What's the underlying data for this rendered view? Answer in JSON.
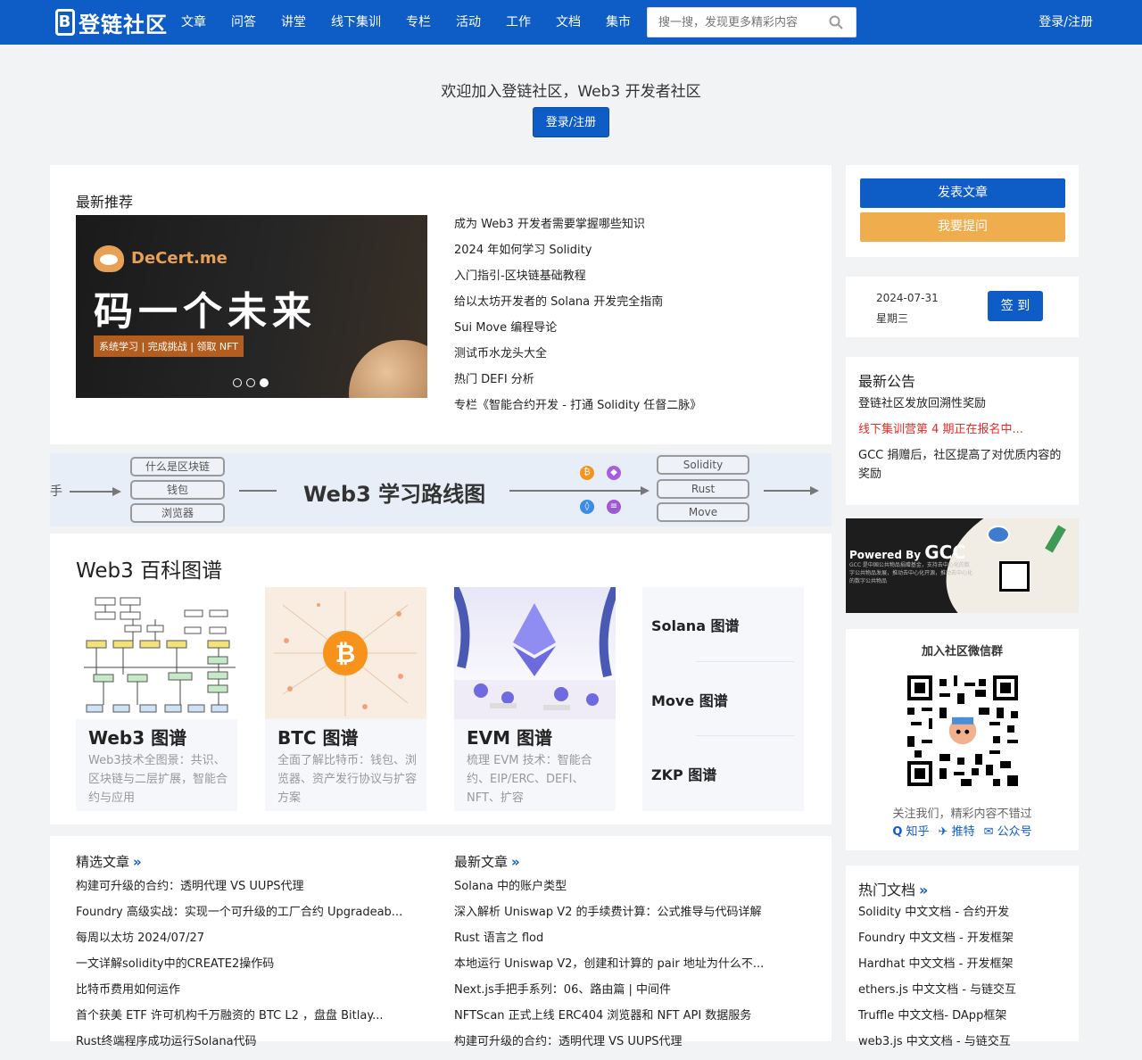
{
  "colors": {
    "primary": "#0e5cc5",
    "warning": "#f0ad4e",
    "alert": "#e52d27"
  },
  "nav": {
    "logo": "登链社区",
    "items": [
      "文章",
      "问答",
      "讲堂",
      "线下集训",
      "专栏",
      "活动",
      "工作",
      "文档",
      "集市"
    ],
    "search_placeholder": "搜一搜，发现更多精彩内容",
    "login": "登录/注册"
  },
  "welcome": {
    "text": "欢迎加入登链社区，Web3 开发者社区",
    "button": "登录/注册"
  },
  "recommend": {
    "title": "最新推荐",
    "banner": {
      "brand": "DeCert.me",
      "headline": "码一个未来",
      "tagline": "系统学习 | 完成挑战 | 领取 NFT"
    },
    "items": [
      "成为 Web3 开发者需要掌握哪些知识",
      "2024 年如何学习 Solidity",
      "入门指引-区块链基础教程",
      "给以太坊开发者的 Solana 开发完全指南",
      "Sui Move 编程导论",
      "测试币水龙头大全",
      "热门 DEFI 分析",
      "专栏《智能合约开发 - 打通 Solidity 任督二脉》"
    ]
  },
  "roadmap": {
    "title": "Web3 学习路线图",
    "left_label": "手",
    "left_boxes": [
      "什么是区块链",
      "钱包",
      "浏览器"
    ],
    "right_boxes": [
      "Solidity",
      "Rust",
      "Move"
    ]
  },
  "wiki": {
    "title": "Web3 百科图谱",
    "cards": [
      {
        "name": "Web3 图谱",
        "desc": "Web3技术全图景：共识、区块链与二层扩展，智能合约与应用"
      },
      {
        "name": "BTC 图谱",
        "desc": "全面了解比特币：钱包、浏览器、资产发行协议与扩容方案"
      },
      {
        "name": "EVM 图谱",
        "desc": "梳理 EVM 技术：智能合约、EIP/ERC、DEFI、NFT、扩容"
      }
    ],
    "side": [
      "Solana 图谱",
      "Move 图谱",
      "ZKP 图谱"
    ]
  },
  "featured": {
    "title": "精选文章",
    "more": "»",
    "items": [
      "构建可升级的合约：透明代理 VS UUPS代理",
      "Foundry 高级实战：实现一个可升级的工厂合约 Upgradeab...",
      "每周以太坊 2024/07/27",
      "一文详解solidity中的CREATE2操作码",
      "比特币费用如何运作",
      "首个获美 ETF 许可机构千万融资的 BTC L2 ，盘盘 Bitlay...",
      "Rust终端程序成功运行Solana代码"
    ]
  },
  "latest": {
    "title": "最新文章",
    "more": "»",
    "items": [
      "Solana 中的账户类型",
      "深入解析 Uniswap V2 的手续费计算：公式推导与代码详解",
      "Rust 语言之 flod",
      "本地运行 Uniswap V2，创建和计算的 pair 地址为什么不...",
      "Next.js手把手系列：06、路由篇 | 中间件",
      "NFTScan 正式上线 ERC404 浏览器和 NFT API 数据服务",
      "构建可升级的合约：透明代理 VS UUPS代理"
    ]
  },
  "sidebar": {
    "post": "发表文章",
    "ask": "我要提问",
    "date": "2024-07-31",
    "weekday": "星期三",
    "sign": "签 到",
    "notice_title": "最新公告",
    "notices": [
      "登链社区发放回溯性奖励",
      "线下集训营第 4 期正在报名中...",
      "GCC 捐赠后，社区提高了对优质内容的奖励"
    ],
    "gcc": {
      "powered": "Powered By",
      "name": "GCC",
      "desc": "GCC 是中国公共物品捐赠基金，支持去中心化的数字公共物品发展，推动去中心化开源，推动去中心化的数字公共物品"
    },
    "wechat_title": "加入社区微信群",
    "wechat_sub": "关注我们，精彩内容不错过",
    "social": [
      "知乎",
      "推特",
      "公众号"
    ],
    "docs_title": "热门文档",
    "docs_more": "»",
    "docs": [
      "Solidity 中文文档 - 合约开发",
      "Foundry 中文文档 - 开发框架",
      "Hardhat 中文文档 - 开发框架",
      "ethers.js 中文文档 - 与链交互",
      "Truffle 中文文档- DApp框架",
      "web3.js 中文文档 - 与链交互"
    ]
  }
}
